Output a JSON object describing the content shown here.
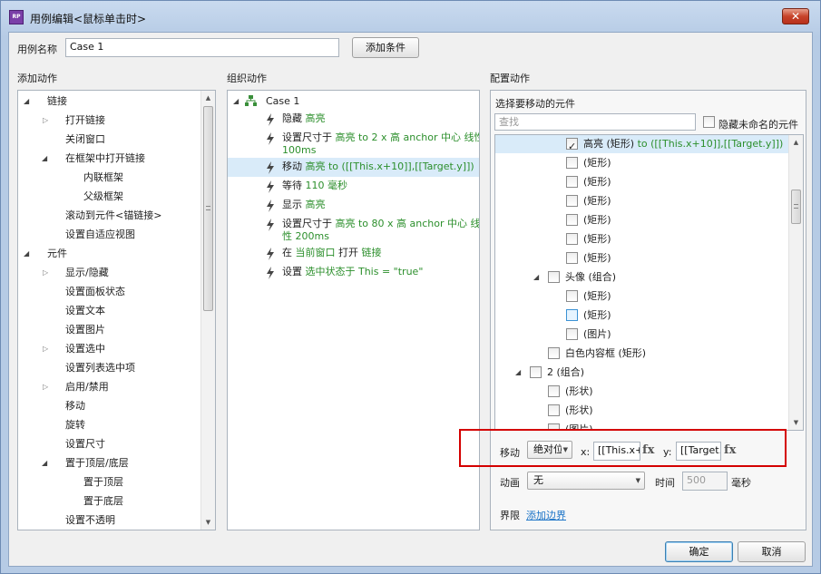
{
  "window": {
    "title": "用例编辑<鼠标单击时>",
    "app_icon": "RP",
    "close_label": "✕"
  },
  "case_name": {
    "label": "用例名称",
    "value": "Case 1",
    "add_condition": "添加条件"
  },
  "sections": {
    "add_action": "添加动作",
    "organize_action": "组织动作",
    "configure_action": "配置动作"
  },
  "add_actions": [
    {
      "label": "链接",
      "level": 0,
      "toggle": "open"
    },
    {
      "label": "打开链接",
      "level": 1,
      "toggle": "closed"
    },
    {
      "label": "关闭窗口",
      "level": 1,
      "toggle": "none"
    },
    {
      "label": "在框架中打开链接",
      "level": 1,
      "toggle": "open"
    },
    {
      "label": "内联框架",
      "level": 2,
      "toggle": "none"
    },
    {
      "label": "父级框架",
      "level": 2,
      "toggle": "none"
    },
    {
      "label": "滚动到元件<锚链接>",
      "level": 1,
      "toggle": "none"
    },
    {
      "label": "设置自适应视图",
      "level": 1,
      "toggle": "none"
    },
    {
      "label": "元件",
      "level": 0,
      "toggle": "open"
    },
    {
      "label": "显示/隐藏",
      "level": 1,
      "toggle": "closed"
    },
    {
      "label": "设置面板状态",
      "level": 1,
      "toggle": "none"
    },
    {
      "label": "设置文本",
      "level": 1,
      "toggle": "none"
    },
    {
      "label": "设置图片",
      "level": 1,
      "toggle": "none"
    },
    {
      "label": "设置选中",
      "level": 1,
      "toggle": "closed"
    },
    {
      "label": "设置列表选中项",
      "level": 1,
      "toggle": "none"
    },
    {
      "label": "启用/禁用",
      "level": 1,
      "toggle": "closed"
    },
    {
      "label": "移动",
      "level": 1,
      "toggle": "none"
    },
    {
      "label": "旋转",
      "level": 1,
      "toggle": "none"
    },
    {
      "label": "设置尺寸",
      "level": 1,
      "toggle": "none"
    },
    {
      "label": "置于顶层/底层",
      "level": 1,
      "toggle": "open"
    },
    {
      "label": "置于顶层",
      "level": 2,
      "toggle": "none"
    },
    {
      "label": "置于底层",
      "level": 2,
      "toggle": "none"
    },
    {
      "label": "设置不透明",
      "level": 1,
      "toggle": "none"
    }
  ],
  "organize": {
    "case_label": "Case 1",
    "actions": [
      {
        "verb": "隐藏",
        "detail": "高亮",
        "detail2": "",
        "selected": false
      },
      {
        "verb": "设置尺寸于",
        "detail": "高亮 to 2 x 高 anchor 中心 线性",
        "detail2": "100ms",
        "selected": false
      },
      {
        "verb": "移动",
        "detail": "高亮 to ([[This.x+10]],[[Target.y]])",
        "detail2": "",
        "selected": true
      },
      {
        "verb": "等待",
        "detail": "110 毫秒",
        "detail2": "",
        "selected": false
      },
      {
        "verb": "显示",
        "detail": "高亮",
        "detail2": "",
        "selected": false
      },
      {
        "verb": "设置尺寸于",
        "detail": "高亮 to 80 x 高 anchor 中心 线",
        "detail2": "性 200ms",
        "selected": false
      },
      {
        "verb": "在",
        "detail": "当前窗口",
        "verb2": "打开",
        "detail3": "链接",
        "detail2": "",
        "selected": false
      },
      {
        "verb": "设置",
        "detail": "选中状态于 This = \"true\"",
        "detail2": "",
        "selected": false
      }
    ]
  },
  "configure": {
    "select_label": "选择要移动的元件",
    "search_placeholder": "查找",
    "hide_unnamed": "隐藏未命名的元件",
    "widgets": [
      {
        "label": "高亮 (矩形)",
        "extra": "to ([[This.x+10]],[[Target.y]])",
        "indent": 0,
        "checked": true,
        "toggle": "none",
        "selected": true
      },
      {
        "label": "(矩形)",
        "extra": "",
        "indent": 0,
        "checked": false,
        "toggle": "none",
        "selected": false
      },
      {
        "label": "(矩形)",
        "extra": "",
        "indent": 0,
        "checked": false,
        "toggle": "none",
        "selected": false
      },
      {
        "label": "(矩形)",
        "extra": "",
        "indent": 0,
        "checked": false,
        "toggle": "none",
        "selected": false
      },
      {
        "label": "(矩形)",
        "extra": "",
        "indent": 0,
        "checked": false,
        "toggle": "none",
        "selected": false
      },
      {
        "label": "(矩形)",
        "extra": "",
        "indent": 0,
        "checked": false,
        "toggle": "none",
        "selected": false
      },
      {
        "label": "(矩形)",
        "extra": "",
        "indent": 0,
        "checked": false,
        "toggle": "none",
        "selected": false
      },
      {
        "label": "头像 (组合)",
        "extra": "",
        "indent": -1,
        "checked": false,
        "toggle": "open",
        "selected": false
      },
      {
        "label": "(矩形)",
        "extra": "",
        "indent": 0,
        "checked": false,
        "toggle": "none",
        "selected": false
      },
      {
        "label": "(矩形)",
        "extra": "",
        "indent": 0,
        "checked": false,
        "toggle": "none",
        "selected": false,
        "focus": true
      },
      {
        "label": "(图片)",
        "extra": "",
        "indent": 0,
        "checked": false,
        "toggle": "none",
        "selected": false
      },
      {
        "label": "白色内容框 (矩形)",
        "extra": "",
        "indent": -1,
        "checked": false,
        "toggle": "none",
        "selected": false
      },
      {
        "label": "2 (组合)",
        "extra": "",
        "indent": -2,
        "checked": false,
        "toggle": "open",
        "selected": false
      },
      {
        "label": "(形状)",
        "extra": "",
        "indent": -1,
        "checked": false,
        "toggle": "none",
        "selected": false
      },
      {
        "label": "(形状)",
        "extra": "",
        "indent": -1,
        "checked": false,
        "toggle": "none",
        "selected": false
      },
      {
        "label": "(图片)",
        "extra": "",
        "indent": -1,
        "checked": false,
        "toggle": "none",
        "selected": false
      }
    ],
    "move": {
      "label": "移动",
      "mode": "绝对位置",
      "x_label": "x:",
      "x_value": "[[This.x+10]]",
      "y_label": "y:",
      "y_value": "[[Target.y]]",
      "fx": "fx"
    },
    "animation": {
      "label": "动画",
      "value": "无",
      "time_label": "时间",
      "time_value": "500",
      "unit": "毫秒"
    },
    "bounds": {
      "label": "界限",
      "link": "添加边界"
    }
  },
  "footer": {
    "ok": "确定",
    "cancel": "取消"
  },
  "colors": {
    "accent_green": "#2c8f2c",
    "selection": "#d9ebf9",
    "highlight_box": "#d40000"
  }
}
